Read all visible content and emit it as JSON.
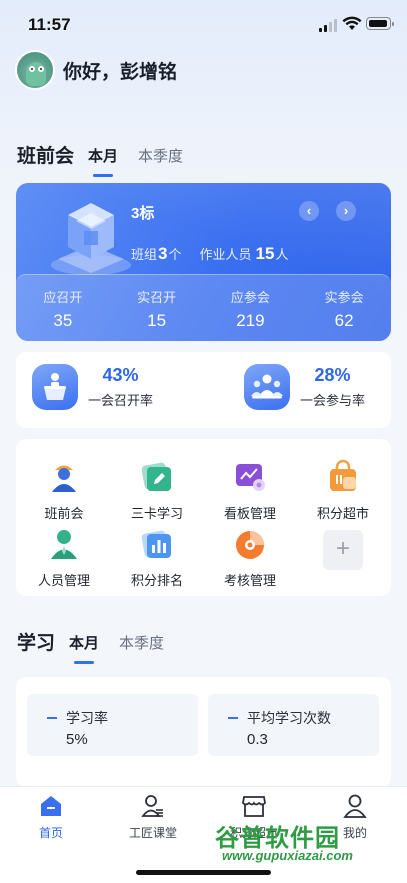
{
  "status": {
    "time": "11:57"
  },
  "header": {
    "greeting": "你好，彭增铭"
  },
  "meeting": {
    "title": "班前会",
    "tabs": [
      "本月",
      "本季度"
    ],
    "team_name": "3标",
    "prev_icon": "chevron-left-icon",
    "next_icon": "chevron-right-icon",
    "team_label": "班组",
    "team_count": "3",
    "team_unit": "个",
    "worker_label": "作业人员",
    "worker_count": "15",
    "worker_unit": "人",
    "stats": [
      {
        "label": "应召开",
        "value": "35"
      },
      {
        "label": "实召开",
        "value": "15"
      },
      {
        "label": "应参会",
        "value": "219"
      },
      {
        "label": "实参会",
        "value": "62"
      }
    ]
  },
  "rates": [
    {
      "value": "43%",
      "label": "一会召开率",
      "icon": "podium-icon"
    },
    {
      "value": "28%",
      "label": "一会参与率",
      "icon": "group-icon"
    }
  ],
  "features": [
    {
      "label": "班前会",
      "icon": "worker-icon"
    },
    {
      "label": "三卡学习",
      "icon": "card-edit-icon"
    },
    {
      "label": "看板管理",
      "icon": "board-icon"
    },
    {
      "label": "积分超市",
      "icon": "shopping-bag-icon"
    },
    {
      "label": "人员管理",
      "icon": "person-icon"
    },
    {
      "label": "积分排名",
      "icon": "bar-chart-icon"
    },
    {
      "label": "考核管理",
      "icon": "pie-chart-icon"
    },
    {
      "label": "+",
      "icon": "plus-icon"
    }
  ],
  "study": {
    "title": "学习",
    "tabs": [
      "本月",
      "本季度"
    ],
    "items": [
      {
        "label": "学习率",
        "value": "5%"
      },
      {
        "label": "平均学习次数",
        "value": "0.3"
      }
    ]
  },
  "nav": [
    {
      "label": "首页",
      "icon": "home-icon"
    },
    {
      "label": "工匠课堂",
      "icon": "classroom-icon"
    },
    {
      "label": "积分超市",
      "icon": "store-icon"
    },
    {
      "label": "我的",
      "icon": "user-icon"
    }
  ],
  "watermark": {
    "text": "谷普软件园",
    "url": "www.gupuxiazai.com"
  },
  "colors": {
    "accent": "#2f6ff0",
    "rate_text": "#2f67e6",
    "card_bg": "#ffffff",
    "page_bg": "#f3f6fb"
  }
}
